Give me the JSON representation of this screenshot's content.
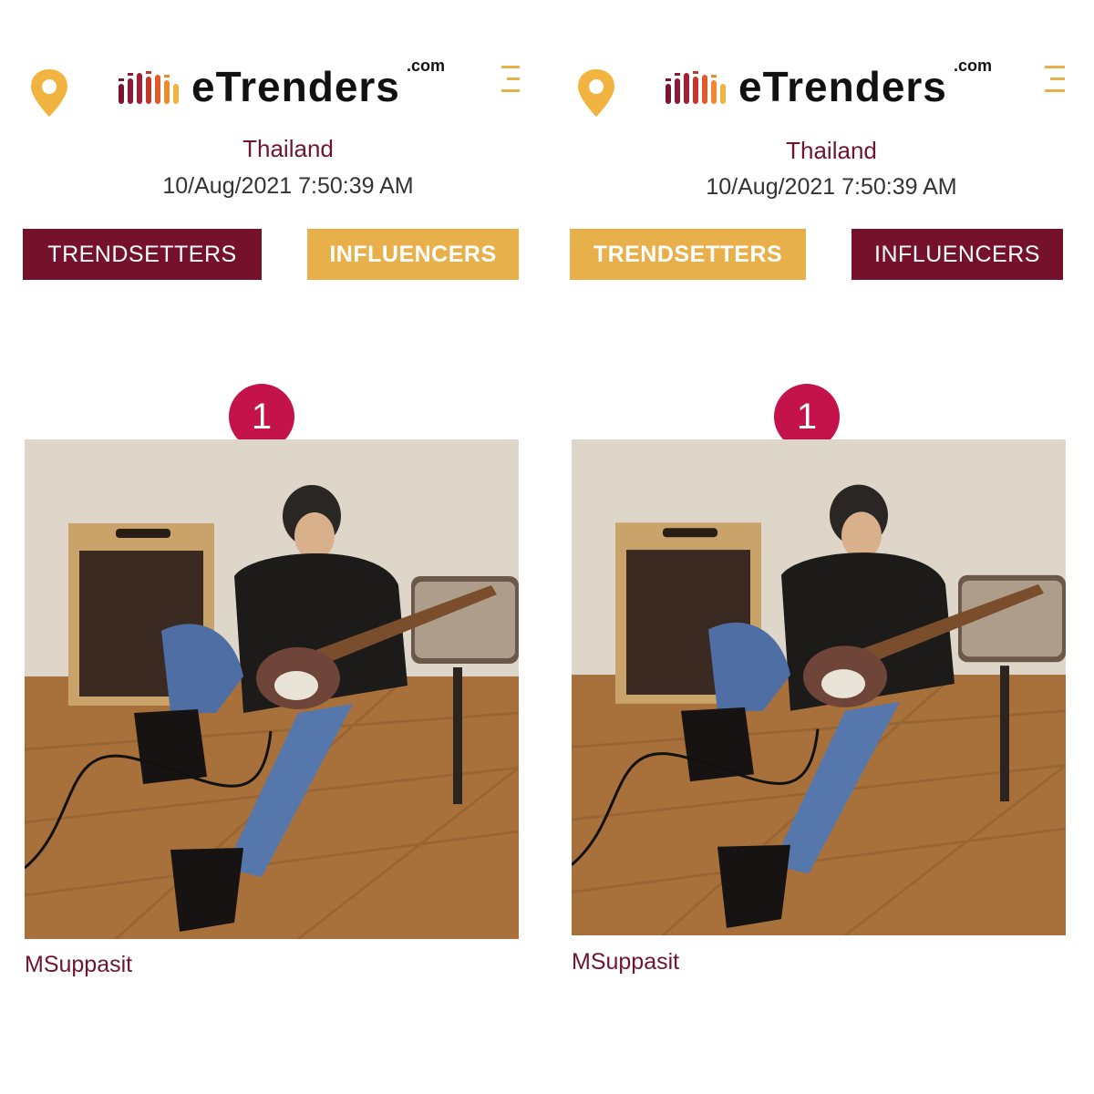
{
  "panels": [
    {
      "brand": {
        "name": "eTrenders",
        "tld": ".com"
      },
      "location": "Thailand",
      "datetime": "10/Aug/2021 7:50:39 AM",
      "tabs": {
        "trendsetters": {
          "label": "TRENDSETTERS",
          "active": false
        },
        "influencers": {
          "label": "INFLUENCERS",
          "active": true
        }
      },
      "entry": {
        "rank": "1",
        "name": "MSuppasit"
      }
    },
    {
      "brand": {
        "name": "eTrenders",
        "tld": ".com"
      },
      "location": "Thailand",
      "datetime": "10/Aug/2021 7:50:39 AM",
      "tabs": {
        "trendsetters": {
          "label": "TRENDSETTERS",
          "active": true
        },
        "influencers": {
          "label": "INFLUENCERS",
          "active": false
        }
      },
      "entry": {
        "rank": "1",
        "name": "MSuppasit"
      }
    }
  ],
  "colors": {
    "maroon": "#76112c",
    "gold": "#e8b04b",
    "rank_badge": "#c4124a",
    "text_maroon": "#6e1430"
  },
  "icons": [
    "location-pin-icon",
    "etrenders-logo",
    "hamburger-menu-icon"
  ]
}
